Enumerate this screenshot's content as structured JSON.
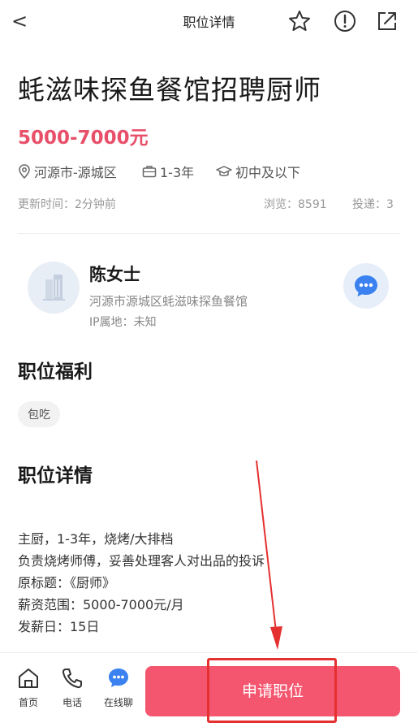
{
  "header": {
    "title": "职位详情",
    "back_symbol": "<"
  },
  "job": {
    "title": "蚝滋味探鱼餐馆招聘厨师",
    "salary": "5000-7000元",
    "location": "河源市-源城区",
    "experience": "1-3年",
    "education": "初中及以下",
    "updated": "更新时间：2分钟前",
    "views": "浏览：8591",
    "applies": "投递：3"
  },
  "company": {
    "contact_name": "陈女士",
    "company_name": "河源市源城区蚝滋味探鱼餐馆",
    "ip": "IP属地：未知"
  },
  "welfare": {
    "title": "职位福利",
    "tags": [
      "包吃"
    ]
  },
  "details": {
    "title": "职位详情",
    "lines": [
      "主厨，1-3年，烧烤/大排档",
      "负责烧烤师傅，妥善处理客人对出品的投诉",
      "原标题：《厨师》",
      "薪资范围：5000-7000元/月",
      "发薪日：15日"
    ]
  },
  "bottom_nav": {
    "home": "首页",
    "phone": "电话",
    "chat": "在线聊",
    "apply": "申请职位"
  },
  "colors": {
    "accent": "#f4566f",
    "salary": "#e8506a",
    "annotation": "#e53030"
  },
  "icons": [
    "back-icon",
    "star-icon",
    "report-icon",
    "share-icon",
    "location-icon",
    "briefcase-icon",
    "graduation-cap-icon",
    "building-icon",
    "chat-bubble-icon",
    "home-icon",
    "phone-icon"
  ]
}
